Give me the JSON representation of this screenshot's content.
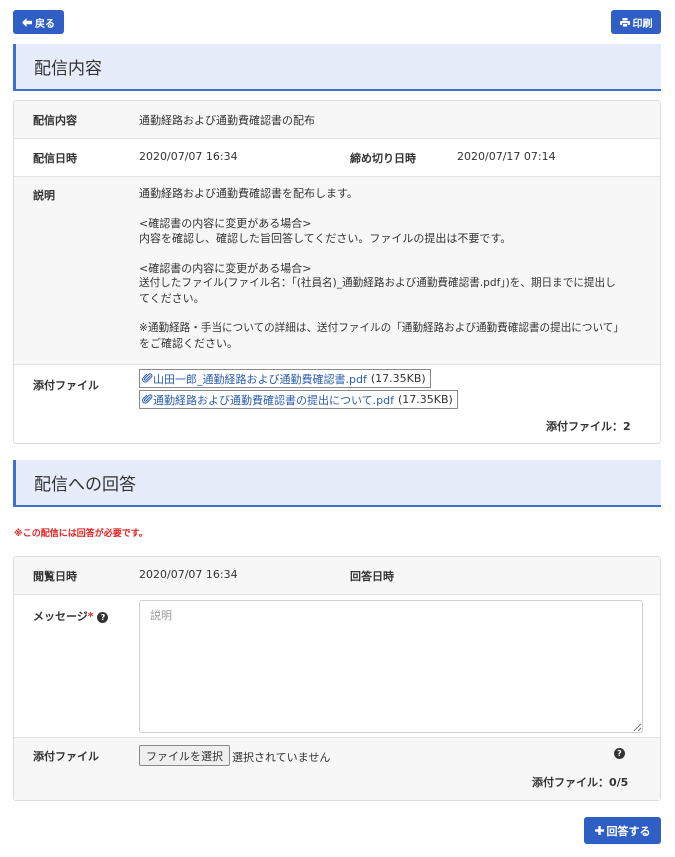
{
  "toolbar": {
    "back_label": "戻る",
    "print_label": "印刷"
  },
  "distribution": {
    "section_title": "配信内容",
    "content_label": "配信内容",
    "content_value": "通勤経路および通勤費確認書の配布",
    "date_label": "配信日時",
    "date_value": "2020/07/07 16:34",
    "deadline_label": "締め切り日時",
    "deadline_value": "2020/07/17 07:14",
    "description_label": "説明",
    "description_lines": [
      "通勤経路および通勤費確認書を配布します。",
      "<確認書の内容に変更がある場合>",
      "内容を確認し、確認した旨回答してください。ファイルの提出は不要です。",
      "<確認書の内容に変更がある場合>",
      "送付したファイル(ファイル名：「(社員名)_通勤経路および通勤費確認書.pdf」)を、期日までに提出し",
      "てください。",
      "※通勤経路・手当についての詳細は、送付ファイルの「通勤経路および通勤費確認書の提出について」",
      "をご確認ください。"
    ],
    "attachments_label": "添付ファイル",
    "attachments": [
      {
        "name": "山田一郎_通勤経路および通勤費確認書.pdf",
        "size": "(17.35KB)"
      },
      {
        "name": "通勤経路および通勤費確認書の提出について.pdf",
        "size": "(17.35KB)"
      }
    ],
    "attachment_count": "添付ファイル：2"
  },
  "response": {
    "section_title": "配信への回答",
    "required_note": "※この配信には回答が必要です。",
    "viewed_label": "閲覧日時",
    "viewed_value": "2020/07/07 16:34",
    "answer_date_label": "回答日時",
    "message_label": "メッセージ",
    "required_mark": "*",
    "message_placeholder": "説明",
    "attachments_label": "添付ファイル",
    "choose_file_label": "ファイルを選択",
    "no_file_text": "選択されていません",
    "attachment_count": "添付ファイル：0/5",
    "help_glyph": "?",
    "submit_label": "回答する"
  },
  "colors": {
    "accent": "#2f5fc4",
    "header_bg": "#e7ecfb",
    "required": "#e02020",
    "link": "#2a5db0"
  }
}
